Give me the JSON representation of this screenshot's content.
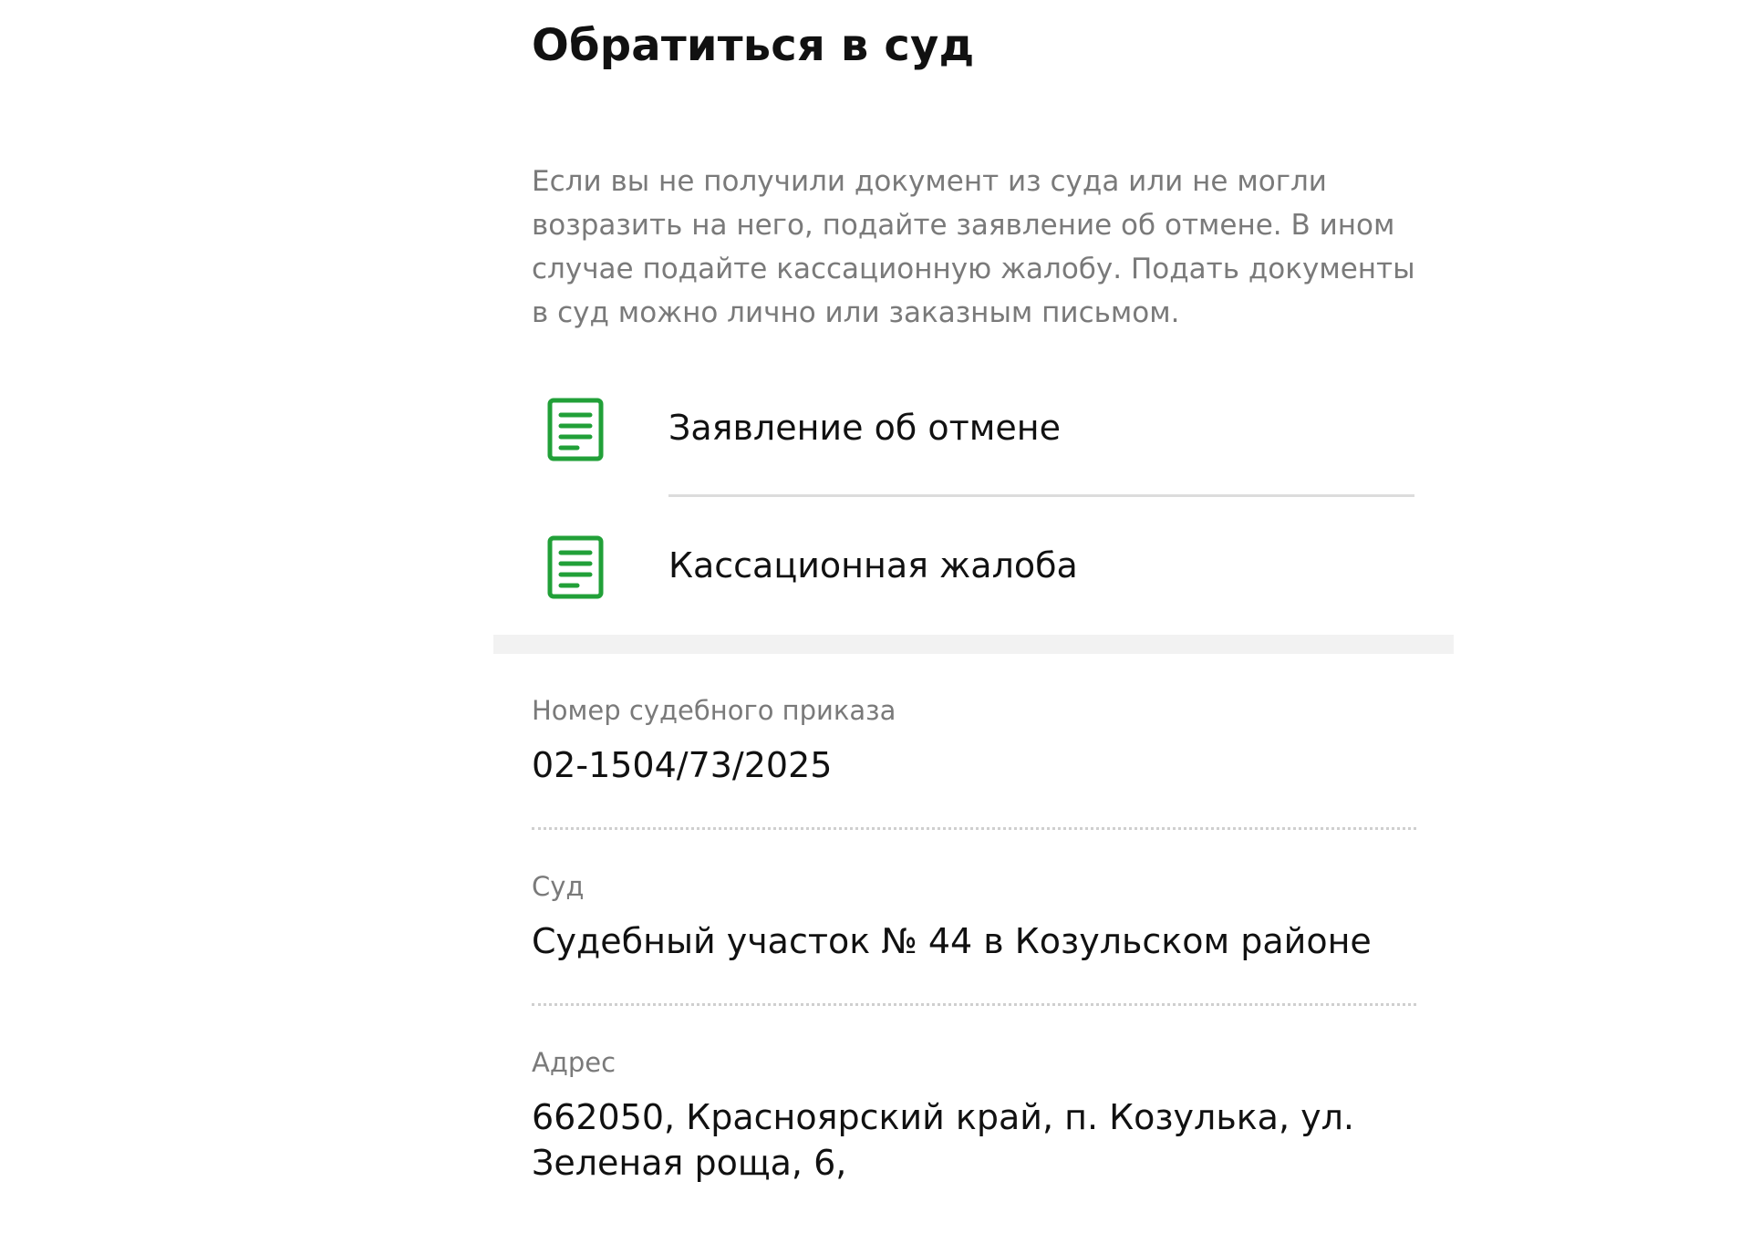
{
  "page": {
    "title": "Обратиться в суд",
    "intro": "Если вы не получили документ из суда или не могли возразить на него, подайте заявление об отмене. В ином случае подайте кассационную жалобу. Подать документы в суд можно лично или заказным письмом."
  },
  "documents": [
    {
      "label": "Заявление об отмене",
      "icon": "document-icon"
    },
    {
      "label": "Кассационная жалоба",
      "icon": "document-icon"
    }
  ],
  "fields": [
    {
      "label": "Номер судебного приказа",
      "value": "02-1504/73/2025"
    },
    {
      "label": "Суд",
      "value": "Судебный участок № 44 в Козульском районе"
    },
    {
      "label": "Адрес",
      "value": "662050, Красноярский край, п. Козулька, ул. Зеленая роща, 6,"
    }
  ],
  "colors": {
    "accent": "#21a038",
    "text": "#111111",
    "muted": "#7a7a7a",
    "divider": "#dcdcdc"
  }
}
